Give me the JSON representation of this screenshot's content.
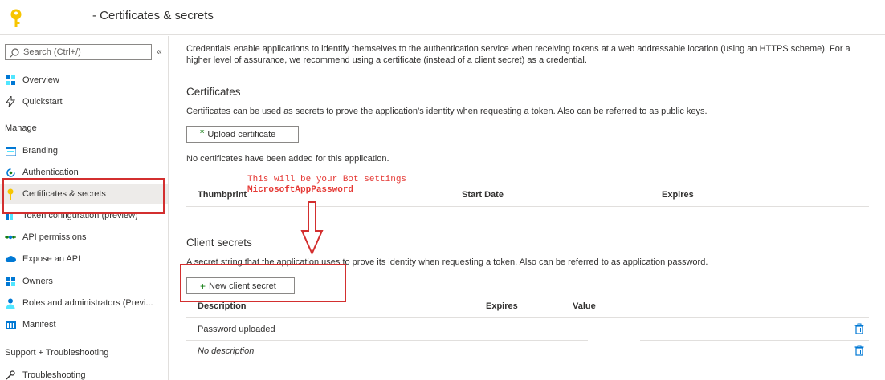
{
  "header": {
    "title": "- Certificates & secrets",
    "icon": "key-icon"
  },
  "sidebar": {
    "search_placeholder": "Search (Ctrl+/)",
    "collapse_glyph": "«",
    "items_top": [
      {
        "label": "Overview",
        "icon": "grid-icon"
      },
      {
        "label": "Quickstart",
        "icon": "lightning-icon"
      }
    ],
    "manage_header": "Manage",
    "manage_items": [
      {
        "label": "Branding",
        "icon": "branding-icon"
      },
      {
        "label": "Authentication",
        "icon": "authentication-icon"
      },
      {
        "label": "Certificates & secrets",
        "icon": "key-icon",
        "selected": true
      },
      {
        "label": "Token configuration (preview)",
        "icon": "token-icon"
      },
      {
        "label": "API permissions",
        "icon": "api-permissions-icon"
      },
      {
        "label": "Expose an API",
        "icon": "cloud-icon"
      },
      {
        "label": "Owners",
        "icon": "owners-icon"
      },
      {
        "label": "Roles and administrators (Previ...",
        "icon": "roles-icon"
      },
      {
        "label": "Manifest",
        "icon": "manifest-icon"
      }
    ],
    "support_header": "Support + Troubleshooting",
    "support_items": [
      {
        "label": "Troubleshooting",
        "icon": "wrench-icon"
      }
    ]
  },
  "main": {
    "intro": "Credentials enable applications to identify themselves to the authentication service when receiving tokens at a web addressable location (using an HTTPS scheme). For a higher level of assurance, we recommend using a certificate (instead of a client secret) as a credential.",
    "certificates": {
      "heading": "Certificates",
      "description": "Certificates can be used as secrets to prove the application’s identity when requesting a token. Also can be referred to as public keys.",
      "upload_button": "Upload certificate",
      "empty_text": "No certificates have been added for this application.",
      "columns": [
        "Thumbprint",
        "Start Date",
        "Expires"
      ]
    },
    "client_secrets": {
      "heading": "Client secrets",
      "description": "A secret string that the application uses to prove its identity when requesting a token. Also can be referred to as application password.",
      "new_button": "New client secret",
      "columns": [
        "Description",
        "Expires",
        "Value"
      ],
      "rows": [
        {
          "description": "Password uploaded"
        },
        {
          "description": "No description"
        }
      ]
    }
  },
  "annotation": {
    "line1": "This will be your Bot settings",
    "line2": "MicrosoftAppPassword",
    "color": "#d32f2f"
  }
}
